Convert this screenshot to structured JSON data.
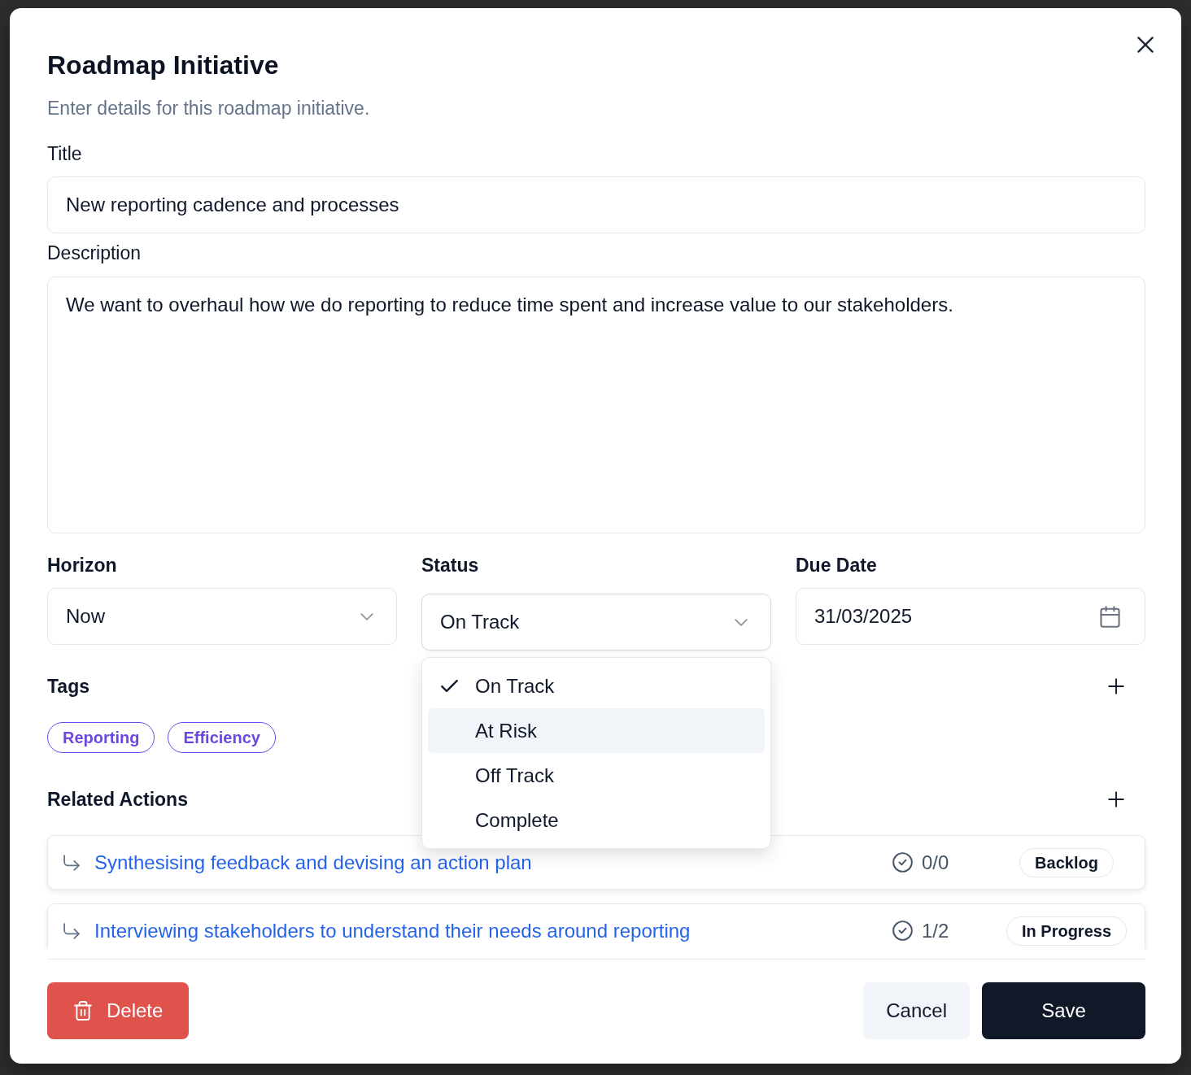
{
  "dialog": {
    "title": "Roadmap Initiative",
    "subtitle": "Enter details for this roadmap initiative."
  },
  "title_field": {
    "label": "Title",
    "value": "New reporting cadence and processes"
  },
  "description_field": {
    "label": "Description",
    "value": "We want to overhaul how we do reporting to reduce time spent and increase value to our stakeholders."
  },
  "horizon": {
    "label": "Horizon",
    "value": "Now"
  },
  "status": {
    "label": "Status",
    "value": "On Track",
    "expanded": true,
    "options": [
      {
        "label": "On Track",
        "selected": true,
        "highlighted": false
      },
      {
        "label": "At Risk",
        "selected": false,
        "highlighted": true
      },
      {
        "label": "Off Track",
        "selected": false,
        "highlighted": false
      },
      {
        "label": "Complete",
        "selected": false,
        "highlighted": false
      }
    ]
  },
  "due_date": {
    "label": "Due Date",
    "value": "31/03/2025"
  },
  "tags": {
    "label": "Tags",
    "items": [
      "Reporting",
      "Efficiency"
    ]
  },
  "related_actions": {
    "label": "Related Actions",
    "items": [
      {
        "title": "Synthesising feedback and devising an action plan",
        "progress": "0/0",
        "status": "Backlog"
      },
      {
        "title": "Interviewing stakeholders to understand their needs around reporting",
        "progress": "1/2",
        "status": "In Progress"
      }
    ]
  },
  "footer": {
    "delete": "Delete",
    "cancel": "Cancel",
    "save": "Save"
  }
}
